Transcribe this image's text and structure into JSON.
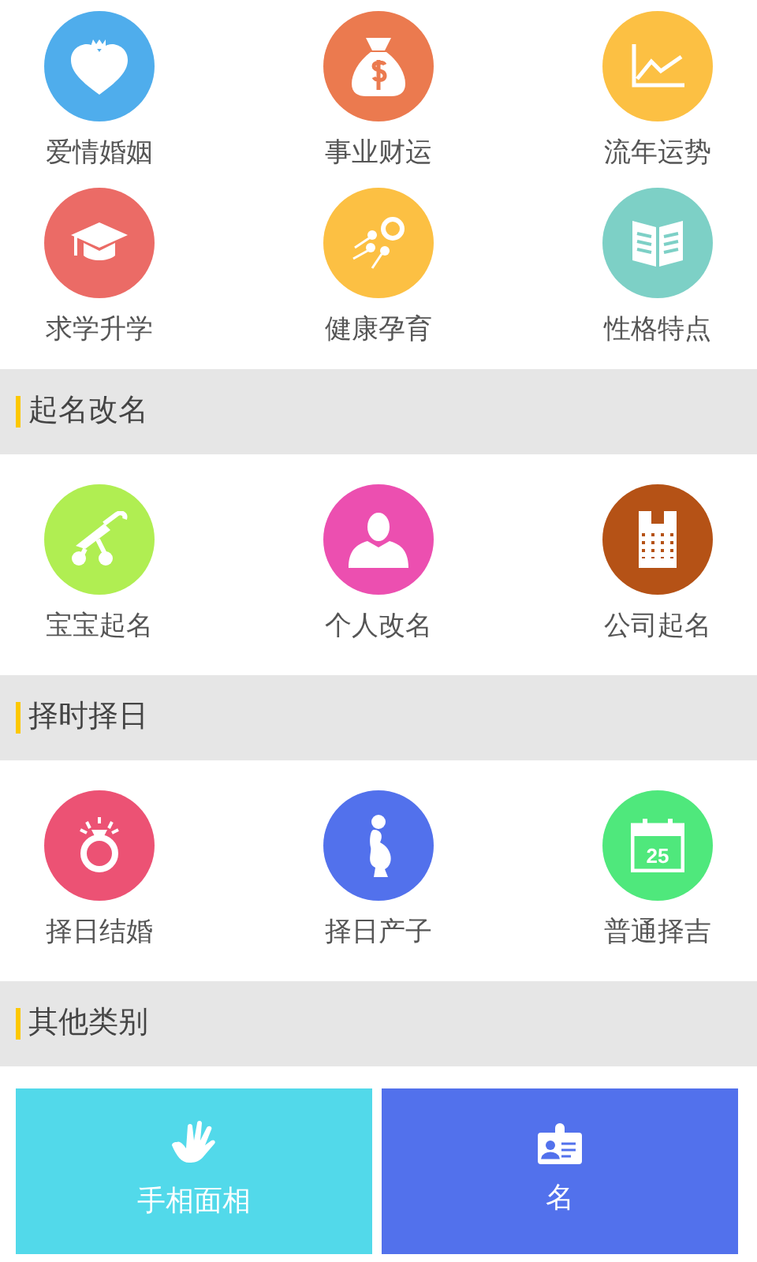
{
  "top_items": [
    {
      "label": "爱情婚姻",
      "kind": "heart",
      "color": "#4fadec"
    },
    {
      "label": "事业财运",
      "kind": "moneybag",
      "color": "#eb7a4f"
    },
    {
      "label": "流年运势",
      "kind": "chart",
      "color": "#fcc043"
    },
    {
      "label": "求学升学",
      "kind": "cap",
      "color": "#eb6b66"
    },
    {
      "label": "健康孕育",
      "kind": "sperm",
      "color": "#fcc043"
    },
    {
      "label": "性格特点",
      "kind": "book",
      "color": "#7dd0c6"
    }
  ],
  "sections": [
    {
      "title": "起名改名",
      "items": [
        {
          "label": "宝宝起名",
          "kind": "stroller",
          "color": "#b0ee52"
        },
        {
          "label": "个人改名",
          "kind": "person",
          "color": "#ec4fb0"
        },
        {
          "label": "公司起名",
          "kind": "building",
          "color": "#b55216"
        }
      ]
    },
    {
      "title": "择时择日",
      "items": [
        {
          "label": "择日结婚",
          "kind": "ring",
          "color": "#ec5274"
        },
        {
          "label": "择日产子",
          "kind": "pregnant",
          "color": "#5271ec"
        },
        {
          "label": "普通择吉",
          "kind": "calendar",
          "color": "#4fe87c",
          "day": "25"
        }
      ]
    },
    {
      "title": "其他类别",
      "cards": [
        {
          "label": "手相面相",
          "kind": "hand",
          "color": "#52d9ea"
        },
        {
          "label": "名",
          "kind": "idcard",
          "color": "#5271ec"
        }
      ]
    }
  ]
}
